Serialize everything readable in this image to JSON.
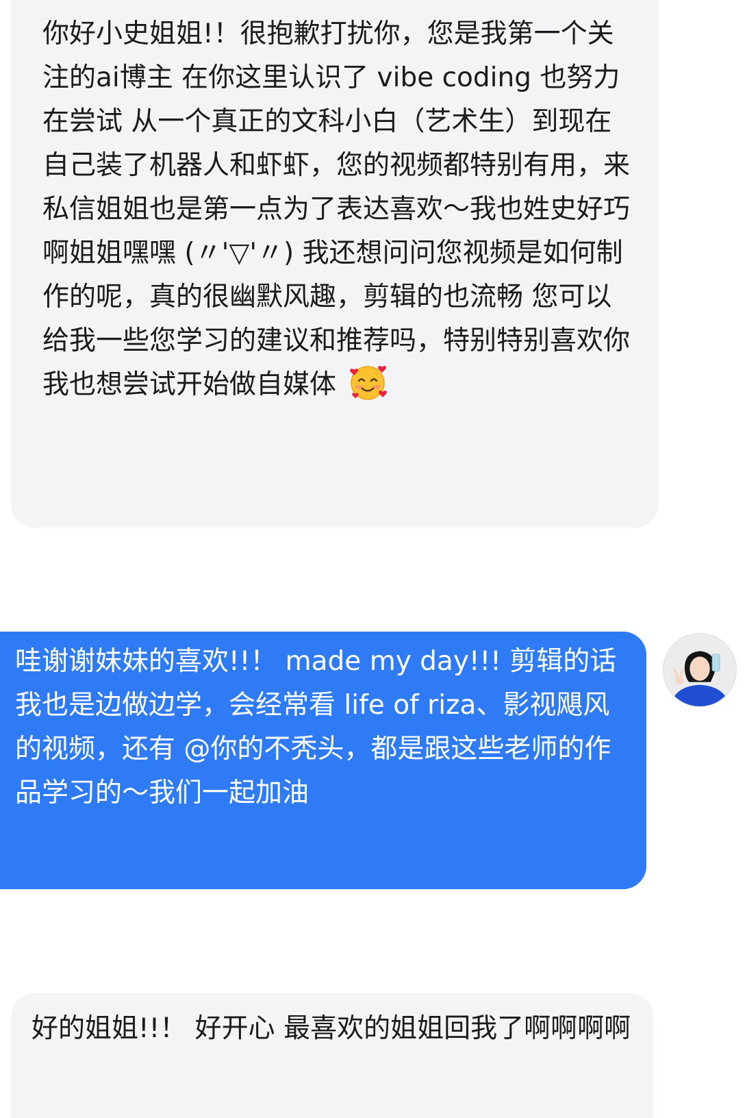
{
  "messages": [
    {
      "direction": "incoming",
      "text": "你好小史姐姐!！很抱歉打扰你，您是我第一个关注的ai博主 在你这里认识了 vibe coding 也努力在尝试 从一个真正的文科小白（艺术生）到现在自己装了机器人和虾虾，您的视频都特别有用，来私信姐姐也是第一点为了表达喜欢～我也姓史好巧啊姐姐嘿嘿 (〃'▽'〃) 我还想问问您视频是如何制作的呢，真的很幽默风趣，剪辑的也流畅 您可以给我一些您学习的建议和推荐吗，特别特别喜欢你 我也想尝试开始做自媒体",
      "emoji": "smiling-face-with-hearts"
    },
    {
      "direction": "outgoing",
      "text": "哇谢谢妹妹的喜欢!!！ made my day!!! 剪辑的话我也是边做边学，会经常看 life of riza、影视飓风的视频，还有 @你的不秃头，都是跟这些老师的作品学习的～我们一起加油"
    },
    {
      "direction": "incoming",
      "text": "好的姐姐!!！ 好开心 最喜欢的姐姐回我了啊啊啊啊"
    }
  ],
  "colors": {
    "incoming_bubble": "#f4f4f6",
    "outgoing_bubble": "#2f7bf6",
    "incoming_text": "#1b1b1b",
    "outgoing_text": "#ffffff"
  }
}
